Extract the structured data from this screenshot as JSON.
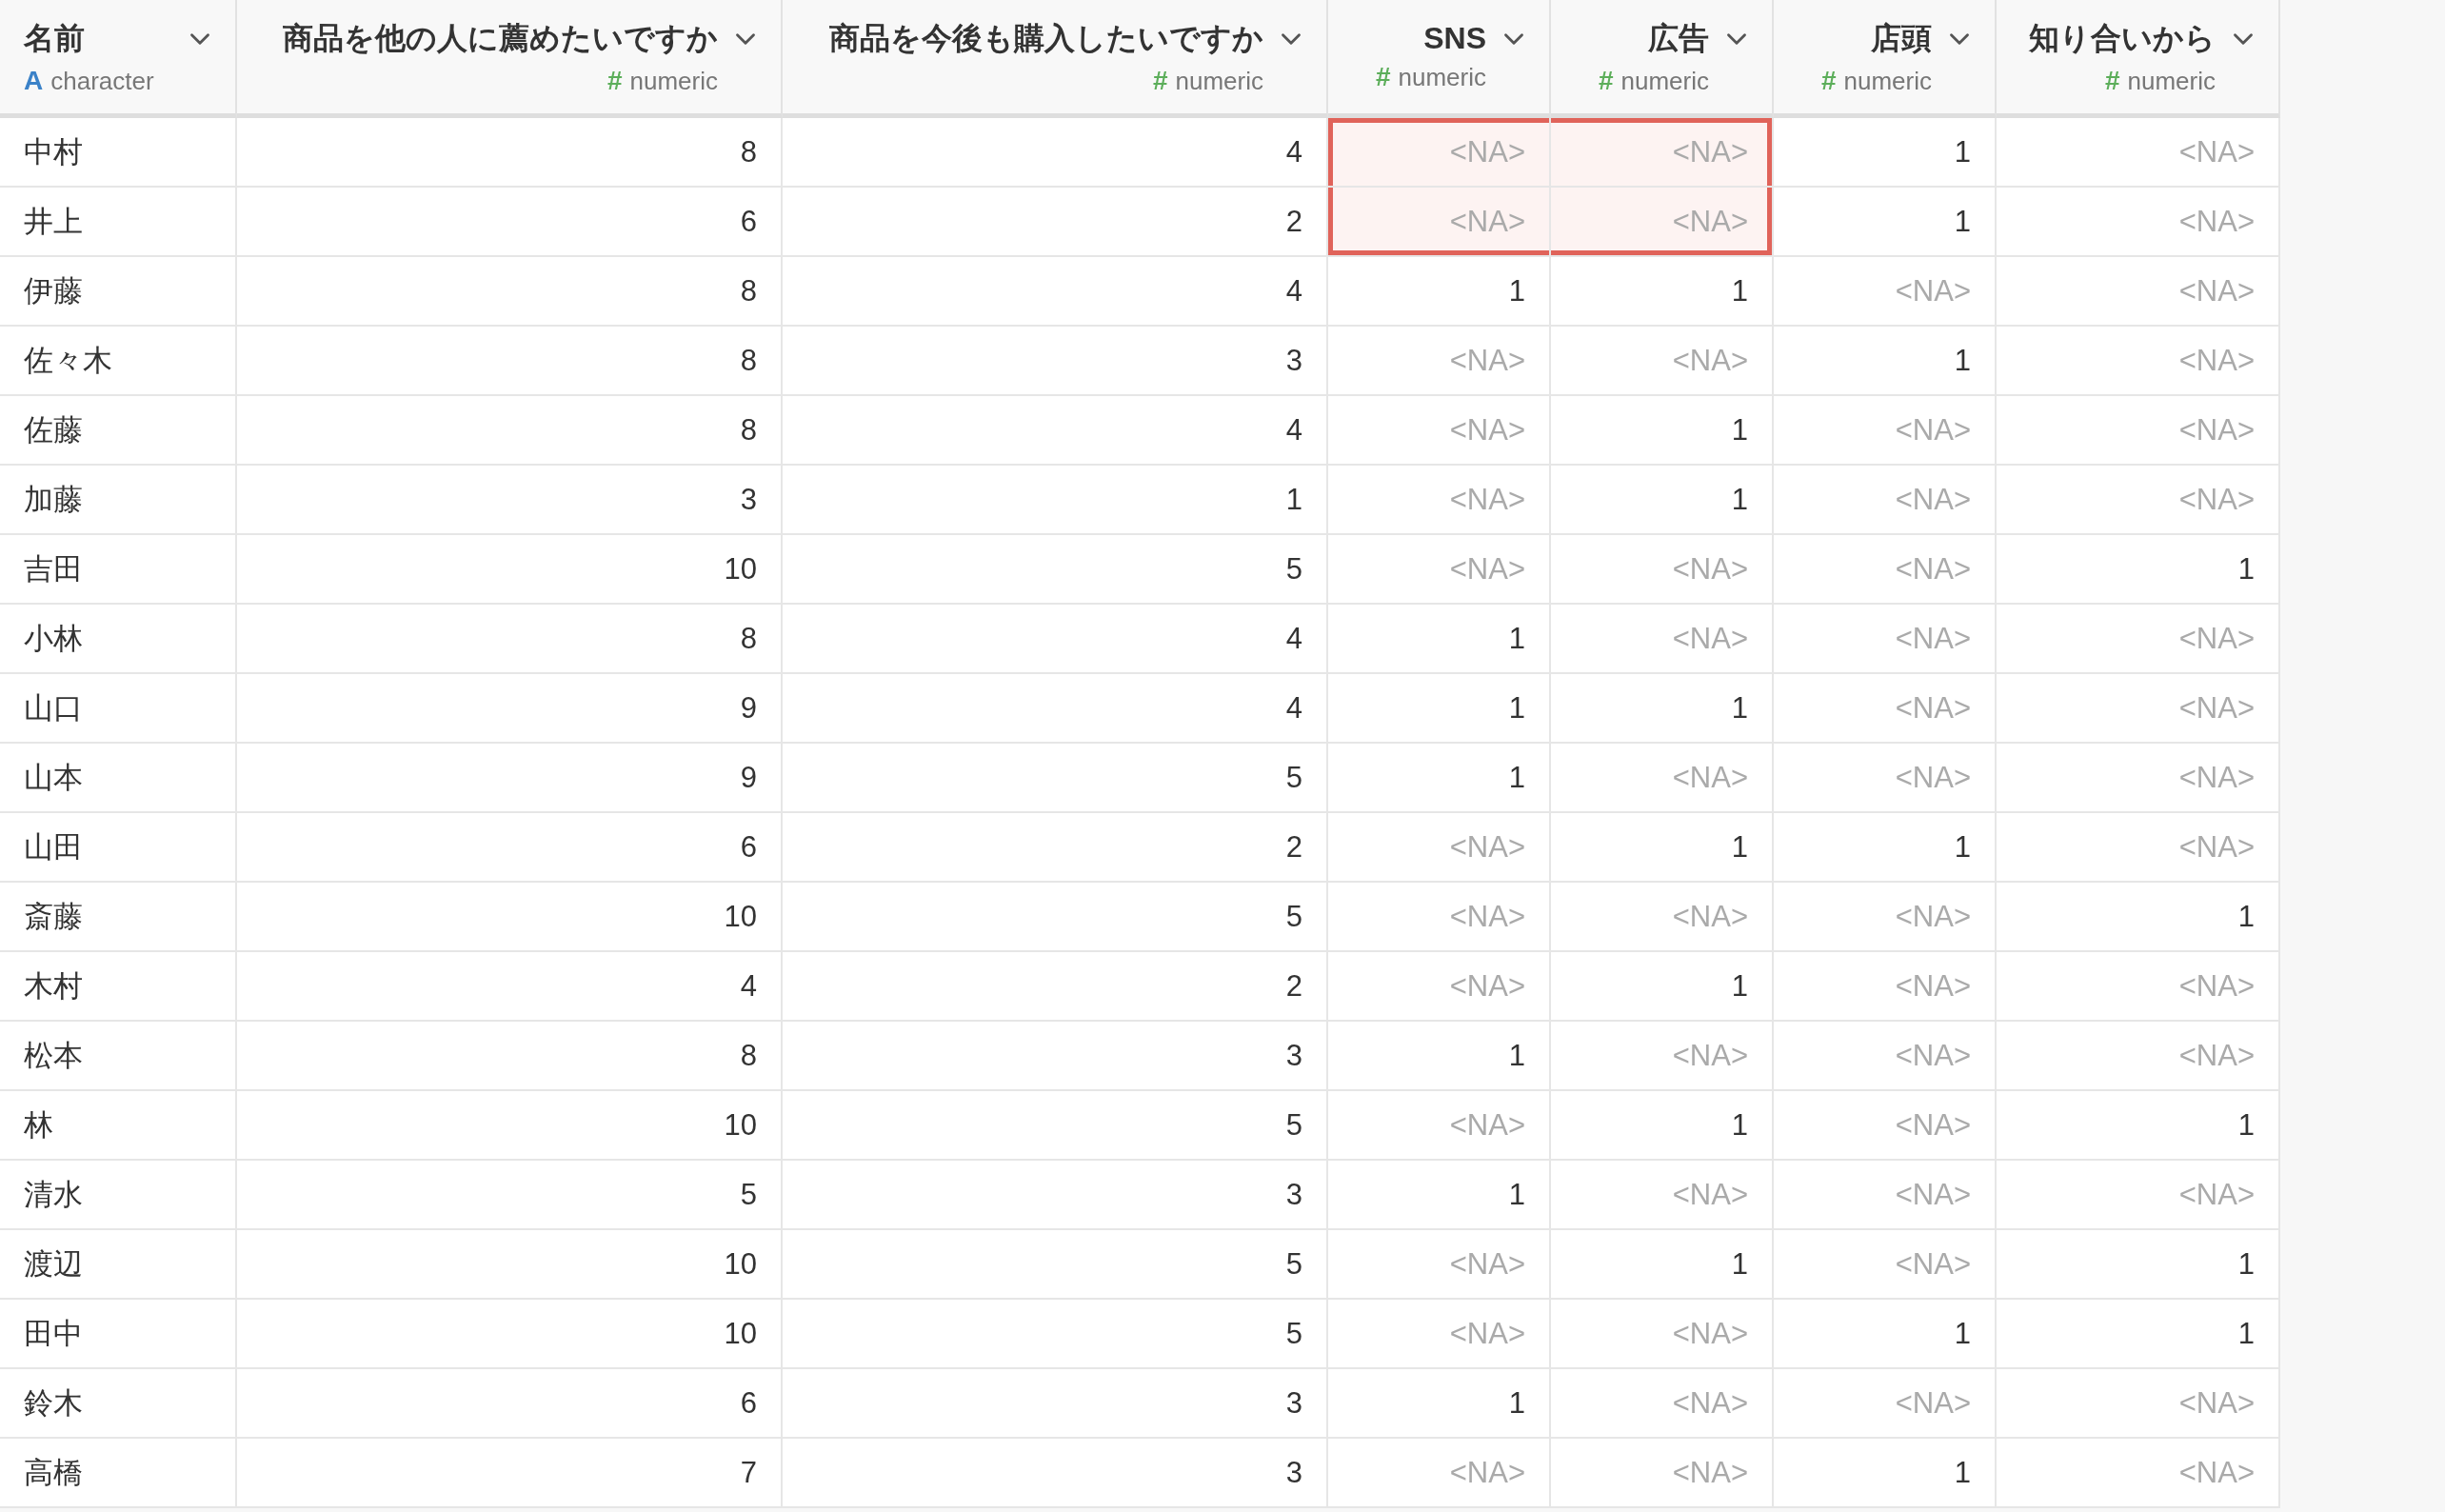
{
  "table": {
    "columns": [
      {
        "name": "名前",
        "type_icon": "A",
        "type": "character",
        "kind": "character"
      },
      {
        "name": "商品を他の人に薦めたいですか",
        "type_icon": "#",
        "type": "numeric",
        "kind": "numeric"
      },
      {
        "name": "商品を今後も購入したいですか",
        "type_icon": "#",
        "type": "numeric",
        "kind": "numeric"
      },
      {
        "name": "SNS",
        "type_icon": "#",
        "type": "numeric",
        "kind": "numeric"
      },
      {
        "name": "広告",
        "type_icon": "#",
        "type": "numeric",
        "kind": "numeric"
      },
      {
        "name": "店頭",
        "type_icon": "#",
        "type": "numeric",
        "kind": "numeric"
      },
      {
        "name": "知り合いから",
        "type_icon": "#",
        "type": "numeric",
        "kind": "numeric"
      }
    ],
    "rows": [
      {
        "cells": [
          {
            "v": "中村",
            "na": false,
            "highlighted": false
          },
          {
            "v": "8",
            "na": false,
            "highlighted": false
          },
          {
            "v": "4",
            "na": false,
            "highlighted": false
          },
          {
            "v": "<NA>",
            "na": true,
            "highlighted": true
          },
          {
            "v": "<NA>",
            "na": true,
            "highlighted": true
          },
          {
            "v": "1",
            "na": false,
            "highlighted": false
          },
          {
            "v": "<NA>",
            "na": true,
            "highlighted": false
          }
        ]
      },
      {
        "cells": [
          {
            "v": "井上",
            "na": false,
            "highlighted": false
          },
          {
            "v": "6",
            "na": false,
            "highlighted": false
          },
          {
            "v": "2",
            "na": false,
            "highlighted": false
          },
          {
            "v": "<NA>",
            "na": true,
            "highlighted": true
          },
          {
            "v": "<NA>",
            "na": true,
            "highlighted": true
          },
          {
            "v": "1",
            "na": false,
            "highlighted": false
          },
          {
            "v": "<NA>",
            "na": true,
            "highlighted": false
          }
        ]
      },
      {
        "cells": [
          {
            "v": "伊藤",
            "na": false,
            "highlighted": false
          },
          {
            "v": "8",
            "na": false,
            "highlighted": false
          },
          {
            "v": "4",
            "na": false,
            "highlighted": false
          },
          {
            "v": "1",
            "na": false,
            "highlighted": false
          },
          {
            "v": "1",
            "na": false,
            "highlighted": false
          },
          {
            "v": "<NA>",
            "na": true,
            "highlighted": false
          },
          {
            "v": "<NA>",
            "na": true,
            "highlighted": false
          }
        ]
      },
      {
        "cells": [
          {
            "v": "佐々木",
            "na": false,
            "highlighted": false
          },
          {
            "v": "8",
            "na": false,
            "highlighted": false
          },
          {
            "v": "3",
            "na": false,
            "highlighted": false
          },
          {
            "v": "<NA>",
            "na": true,
            "highlighted": false
          },
          {
            "v": "<NA>",
            "na": true,
            "highlighted": false
          },
          {
            "v": "1",
            "na": false,
            "highlighted": false
          },
          {
            "v": "<NA>",
            "na": true,
            "highlighted": false
          }
        ]
      },
      {
        "cells": [
          {
            "v": "佐藤",
            "na": false,
            "highlighted": false
          },
          {
            "v": "8",
            "na": false,
            "highlighted": false
          },
          {
            "v": "4",
            "na": false,
            "highlighted": false
          },
          {
            "v": "<NA>",
            "na": true,
            "highlighted": false
          },
          {
            "v": "1",
            "na": false,
            "highlighted": false
          },
          {
            "v": "<NA>",
            "na": true,
            "highlighted": false
          },
          {
            "v": "<NA>",
            "na": true,
            "highlighted": false
          }
        ]
      },
      {
        "cells": [
          {
            "v": "加藤",
            "na": false,
            "highlighted": false
          },
          {
            "v": "3",
            "na": false,
            "highlighted": false
          },
          {
            "v": "1",
            "na": false,
            "highlighted": false
          },
          {
            "v": "<NA>",
            "na": true,
            "highlighted": false
          },
          {
            "v": "1",
            "na": false,
            "highlighted": false
          },
          {
            "v": "<NA>",
            "na": true,
            "highlighted": false
          },
          {
            "v": "<NA>",
            "na": true,
            "highlighted": false
          }
        ]
      },
      {
        "cells": [
          {
            "v": "吉田",
            "na": false,
            "highlighted": false
          },
          {
            "v": "10",
            "na": false,
            "highlighted": false
          },
          {
            "v": "5",
            "na": false,
            "highlighted": false
          },
          {
            "v": "<NA>",
            "na": true,
            "highlighted": false
          },
          {
            "v": "<NA>",
            "na": true,
            "highlighted": false
          },
          {
            "v": "<NA>",
            "na": true,
            "highlighted": false
          },
          {
            "v": "1",
            "na": false,
            "highlighted": false
          }
        ]
      },
      {
        "cells": [
          {
            "v": "小林",
            "na": false,
            "highlighted": false
          },
          {
            "v": "8",
            "na": false,
            "highlighted": false
          },
          {
            "v": "4",
            "na": false,
            "highlighted": false
          },
          {
            "v": "1",
            "na": false,
            "highlighted": false
          },
          {
            "v": "<NA>",
            "na": true,
            "highlighted": false
          },
          {
            "v": "<NA>",
            "na": true,
            "highlighted": false
          },
          {
            "v": "<NA>",
            "na": true,
            "highlighted": false
          }
        ]
      },
      {
        "cells": [
          {
            "v": "山口",
            "na": false,
            "highlighted": false
          },
          {
            "v": "9",
            "na": false,
            "highlighted": false
          },
          {
            "v": "4",
            "na": false,
            "highlighted": false
          },
          {
            "v": "1",
            "na": false,
            "highlighted": false
          },
          {
            "v": "1",
            "na": false,
            "highlighted": false
          },
          {
            "v": "<NA>",
            "na": true,
            "highlighted": false
          },
          {
            "v": "<NA>",
            "na": true,
            "highlighted": false
          }
        ]
      },
      {
        "cells": [
          {
            "v": "山本",
            "na": false,
            "highlighted": false
          },
          {
            "v": "9",
            "na": false,
            "highlighted": false
          },
          {
            "v": "5",
            "na": false,
            "highlighted": false
          },
          {
            "v": "1",
            "na": false,
            "highlighted": false
          },
          {
            "v": "<NA>",
            "na": true,
            "highlighted": false
          },
          {
            "v": "<NA>",
            "na": true,
            "highlighted": false
          },
          {
            "v": "<NA>",
            "na": true,
            "highlighted": false
          }
        ]
      },
      {
        "cells": [
          {
            "v": "山田",
            "na": false,
            "highlighted": false
          },
          {
            "v": "6",
            "na": false,
            "highlighted": false
          },
          {
            "v": "2",
            "na": false,
            "highlighted": false
          },
          {
            "v": "<NA>",
            "na": true,
            "highlighted": false
          },
          {
            "v": "1",
            "na": false,
            "highlighted": false
          },
          {
            "v": "1",
            "na": false,
            "highlighted": false
          },
          {
            "v": "<NA>",
            "na": true,
            "highlighted": false
          }
        ]
      },
      {
        "cells": [
          {
            "v": "斎藤",
            "na": false,
            "highlighted": false
          },
          {
            "v": "10",
            "na": false,
            "highlighted": false
          },
          {
            "v": "5",
            "na": false,
            "highlighted": false
          },
          {
            "v": "<NA>",
            "na": true,
            "highlighted": false
          },
          {
            "v": "<NA>",
            "na": true,
            "highlighted": false
          },
          {
            "v": "<NA>",
            "na": true,
            "highlighted": false
          },
          {
            "v": "1",
            "na": false,
            "highlighted": false
          }
        ]
      },
      {
        "cells": [
          {
            "v": "木村",
            "na": false,
            "highlighted": false
          },
          {
            "v": "4",
            "na": false,
            "highlighted": false
          },
          {
            "v": "2",
            "na": false,
            "highlighted": false
          },
          {
            "v": "<NA>",
            "na": true,
            "highlighted": false
          },
          {
            "v": "1",
            "na": false,
            "highlighted": false
          },
          {
            "v": "<NA>",
            "na": true,
            "highlighted": false
          },
          {
            "v": "<NA>",
            "na": true,
            "highlighted": false
          }
        ]
      },
      {
        "cells": [
          {
            "v": "松本",
            "na": false,
            "highlighted": false
          },
          {
            "v": "8",
            "na": false,
            "highlighted": false
          },
          {
            "v": "3",
            "na": false,
            "highlighted": false
          },
          {
            "v": "1",
            "na": false,
            "highlighted": false
          },
          {
            "v": "<NA>",
            "na": true,
            "highlighted": false
          },
          {
            "v": "<NA>",
            "na": true,
            "highlighted": false
          },
          {
            "v": "<NA>",
            "na": true,
            "highlighted": false
          }
        ]
      },
      {
        "cells": [
          {
            "v": "林",
            "na": false,
            "highlighted": false
          },
          {
            "v": "10",
            "na": false,
            "highlighted": false
          },
          {
            "v": "5",
            "na": false,
            "highlighted": false
          },
          {
            "v": "<NA>",
            "na": true,
            "highlighted": false
          },
          {
            "v": "1",
            "na": false,
            "highlighted": false
          },
          {
            "v": "<NA>",
            "na": true,
            "highlighted": false
          },
          {
            "v": "1",
            "na": false,
            "highlighted": false
          }
        ]
      },
      {
        "cells": [
          {
            "v": "清水",
            "na": false,
            "highlighted": false
          },
          {
            "v": "5",
            "na": false,
            "highlighted": false
          },
          {
            "v": "3",
            "na": false,
            "highlighted": false
          },
          {
            "v": "1",
            "na": false,
            "highlighted": false
          },
          {
            "v": "<NA>",
            "na": true,
            "highlighted": false
          },
          {
            "v": "<NA>",
            "na": true,
            "highlighted": false
          },
          {
            "v": "<NA>",
            "na": true,
            "highlighted": false
          }
        ]
      },
      {
        "cells": [
          {
            "v": "渡辺",
            "na": false,
            "highlighted": false
          },
          {
            "v": "10",
            "na": false,
            "highlighted": false
          },
          {
            "v": "5",
            "na": false,
            "highlighted": false
          },
          {
            "v": "<NA>",
            "na": true,
            "highlighted": false
          },
          {
            "v": "1",
            "na": false,
            "highlighted": false
          },
          {
            "v": "<NA>",
            "na": true,
            "highlighted": false
          },
          {
            "v": "1",
            "na": false,
            "highlighted": false
          }
        ]
      },
      {
        "cells": [
          {
            "v": "田中",
            "na": false,
            "highlighted": false
          },
          {
            "v": "10",
            "na": false,
            "highlighted": false
          },
          {
            "v": "5",
            "na": false,
            "highlighted": false
          },
          {
            "v": "<NA>",
            "na": true,
            "highlighted": false
          },
          {
            "v": "<NA>",
            "na": true,
            "highlighted": false
          },
          {
            "v": "1",
            "na": false,
            "highlighted": false
          },
          {
            "v": "1",
            "na": false,
            "highlighted": false
          }
        ]
      },
      {
        "cells": [
          {
            "v": "鈴木",
            "na": false,
            "highlighted": false
          },
          {
            "v": "6",
            "na": false,
            "highlighted": false
          },
          {
            "v": "3",
            "na": false,
            "highlighted": false
          },
          {
            "v": "1",
            "na": false,
            "highlighted": false
          },
          {
            "v": "<NA>",
            "na": true,
            "highlighted": false
          },
          {
            "v": "<NA>",
            "na": true,
            "highlighted": false
          },
          {
            "v": "<NA>",
            "na": true,
            "highlighted": false
          }
        ]
      },
      {
        "cells": [
          {
            "v": "高橋",
            "na": false,
            "highlighted": false
          },
          {
            "v": "7",
            "na": false,
            "highlighted": false
          },
          {
            "v": "3",
            "na": false,
            "highlighted": false
          },
          {
            "v": "<NA>",
            "na": true,
            "highlighted": false
          },
          {
            "v": "<NA>",
            "na": true,
            "highlighted": false
          },
          {
            "v": "1",
            "na": false,
            "highlighted": false
          },
          {
            "v": "<NA>",
            "na": true,
            "highlighted": false
          }
        ]
      }
    ]
  }
}
